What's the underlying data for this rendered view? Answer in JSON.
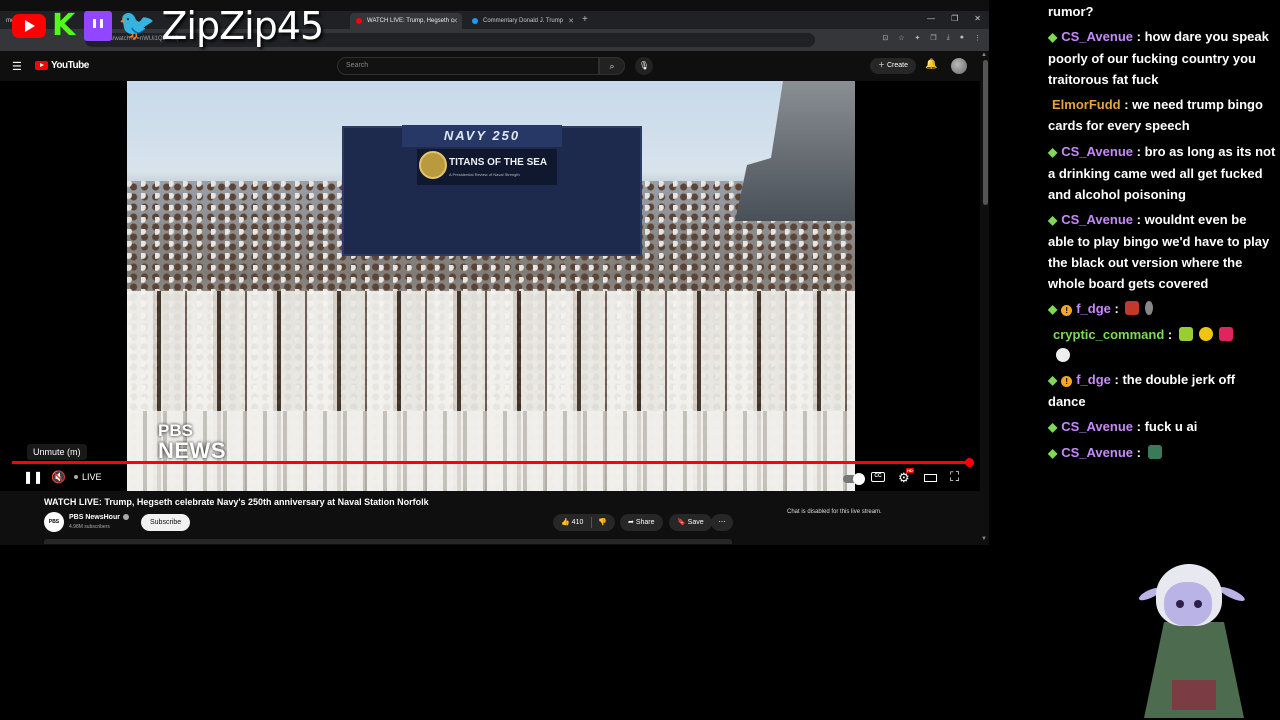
{
  "overlay": {
    "handle": "ZipZip45",
    "icons": [
      "youtube-icon",
      "kick-icon",
      "twitch-icon",
      "twitter-icon"
    ]
  },
  "browser": {
    "tabs": [
      {
        "label": "me",
        "active": false
      },
      {
        "label": "WATCH LIVE: Trump, Hegseth c",
        "active": true
      },
      {
        "label": "Commentary Donald J. Trump",
        "active": false
      }
    ],
    "new_tab": "+",
    "address": "be.com/watch?v=nWUi1Q3lV8Q"
  },
  "youtube": {
    "brand": "YouTube",
    "search_placeholder": "Search",
    "create_label": "Create"
  },
  "video": {
    "stage_banner": "NAVY 250",
    "stage_title": "TITANS OF THE SEA",
    "stage_subtitle": "A Presidential Review of Naval Strength",
    "watermark_line1": "PBS",
    "watermark_line2": "NEWS",
    "tooltip": "Unmute (m)",
    "live_label": "LIVE",
    "progress_fraction": 1.0,
    "title": "WATCH LIVE: Trump, Hegseth celebrate Navy's 250th anniversary at Naval Station Norfolk"
  },
  "channel": {
    "avatar_text": "PBS NEWS",
    "name": "PBS NewsHour",
    "subscribers": "4.98M subscribers",
    "subscribe_label": "Subscribe"
  },
  "actions": {
    "likes": "410",
    "share_label": "Share",
    "save_label": "Save",
    "more_label": "⋯"
  },
  "chat_disabled": "Chat is disabled for this live stream.",
  "chat": [
    {
      "user": "",
      "color": "#ffffff",
      "text": "rumor?",
      "badge": "none"
    },
    {
      "user": "CS_Avenue",
      "color": "#c58af9",
      "text": "how dare you speak poorly of our fucking country you traitorous fat fuck",
      "badge": "gem"
    },
    {
      "user": "ElmorFudd",
      "color": "#e6a23c",
      "text": "we need trump bingo cards for every speech",
      "badge": "none"
    },
    {
      "user": "CS_Avenue",
      "color": "#c58af9",
      "text": "bro as long as its not a drinking came wed all get fucked and alcohol poisoning",
      "badge": "gem"
    },
    {
      "user": "CS_Avenue",
      "color": "#c58af9",
      "text": "wouldnt even be able to play bingo we'd have to play the black out version where the whole board gets covered",
      "badge": "gem"
    },
    {
      "user": "f_dge",
      "color": "#c58af9",
      "text": "",
      "badge": "gem-coin"
    },
    {
      "user": "cryptic_command",
      "color": "#7ed957",
      "text": "",
      "badge": "none"
    },
    {
      "user": "f_dge",
      "color": "#c58af9",
      "text": "the double jerk off dance",
      "badge": "gem-coin"
    },
    {
      "user": "CS_Avenue",
      "color": "#c58af9",
      "text": "fuck u ai",
      "badge": "gem"
    },
    {
      "user": "CS_Avenue",
      "color": "#c58af9",
      "text": "",
      "badge": "gem"
    }
  ]
}
